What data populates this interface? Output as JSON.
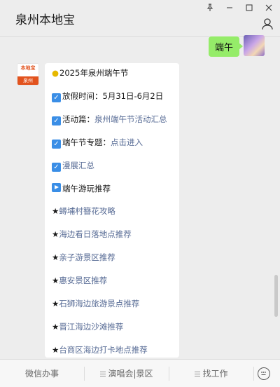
{
  "window": {
    "title": "泉州本地宝",
    "controls": {
      "pin": "pin-icon",
      "minimize": "minimize-icon",
      "maximize": "maximize-icon",
      "close": "close-icon"
    }
  },
  "outgoing_message": {
    "text": "端午"
  },
  "bot_avatar": {
    "top_text": "本地宝",
    "bottom_text": "泉州"
  },
  "message": {
    "heading": "2025年泉州端午节",
    "holiday_label": "放假时间：",
    "holiday_value": "5月31日-6月2日",
    "activity_label": "活动篇：",
    "activity_link": "泉州端午节活动汇总",
    "topic_label": "端午节专题：",
    "topic_link": "点击进入",
    "exhibition_link": "漫展汇总",
    "recommend_heading": "端午游玩推荐",
    "star": "★",
    "recommendations": [
      "蟳埔村簪花攻略",
      "海边看日落地点推荐",
      "亲子游景区推荐",
      "惠安景区推荐",
      "石狮海边旅游景点推荐",
      "晋江海边沙滩推荐",
      "台商区海边打卡地点推荐"
    ]
  },
  "bottom_menu": {
    "item1": "微信办事",
    "item2": "演唱会|景区",
    "item3": "找工作"
  },
  "icons": {
    "keyboard": "keyboard-icon",
    "profile": "profile-icon"
  }
}
